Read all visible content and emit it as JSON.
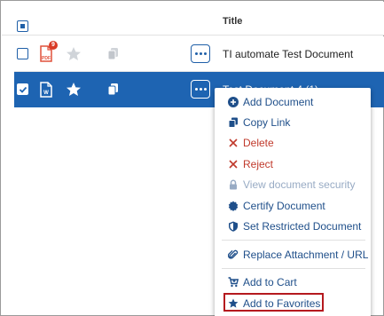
{
  "header": {
    "title_column": "Title"
  },
  "rows": [
    {
      "title": "TI automate Test Document",
      "file_type": "PDF",
      "badge": "9",
      "favorite": false,
      "selected": false
    },
    {
      "title": "Test Document 4 (1)",
      "file_type": "W",
      "favorite": true,
      "selected": true
    }
  ],
  "menu": {
    "items": [
      {
        "label": "Add Document",
        "icon": "plus-circle-icon"
      },
      {
        "label": "Copy Link",
        "icon": "copy-icon"
      },
      {
        "label": "Delete",
        "icon": "x-icon"
      },
      {
        "label": "Reject",
        "icon": "x-icon"
      },
      {
        "label": "View document security",
        "icon": "lock-icon"
      },
      {
        "label": "Certify Document",
        "icon": "seal-icon"
      },
      {
        "label": "Set Restricted Document",
        "icon": "shield-icon"
      },
      {
        "label": "Replace Attachment / URL",
        "icon": "paperclip-icon"
      },
      {
        "label": "Add to Cart",
        "icon": "cart-icon"
      },
      {
        "label": "Add to Favorites",
        "icon": "star-icon"
      }
    ]
  },
  "colors": {
    "accent": "#1e64b2",
    "danger": "#c0392b",
    "highlight_border": "#b5191e"
  }
}
